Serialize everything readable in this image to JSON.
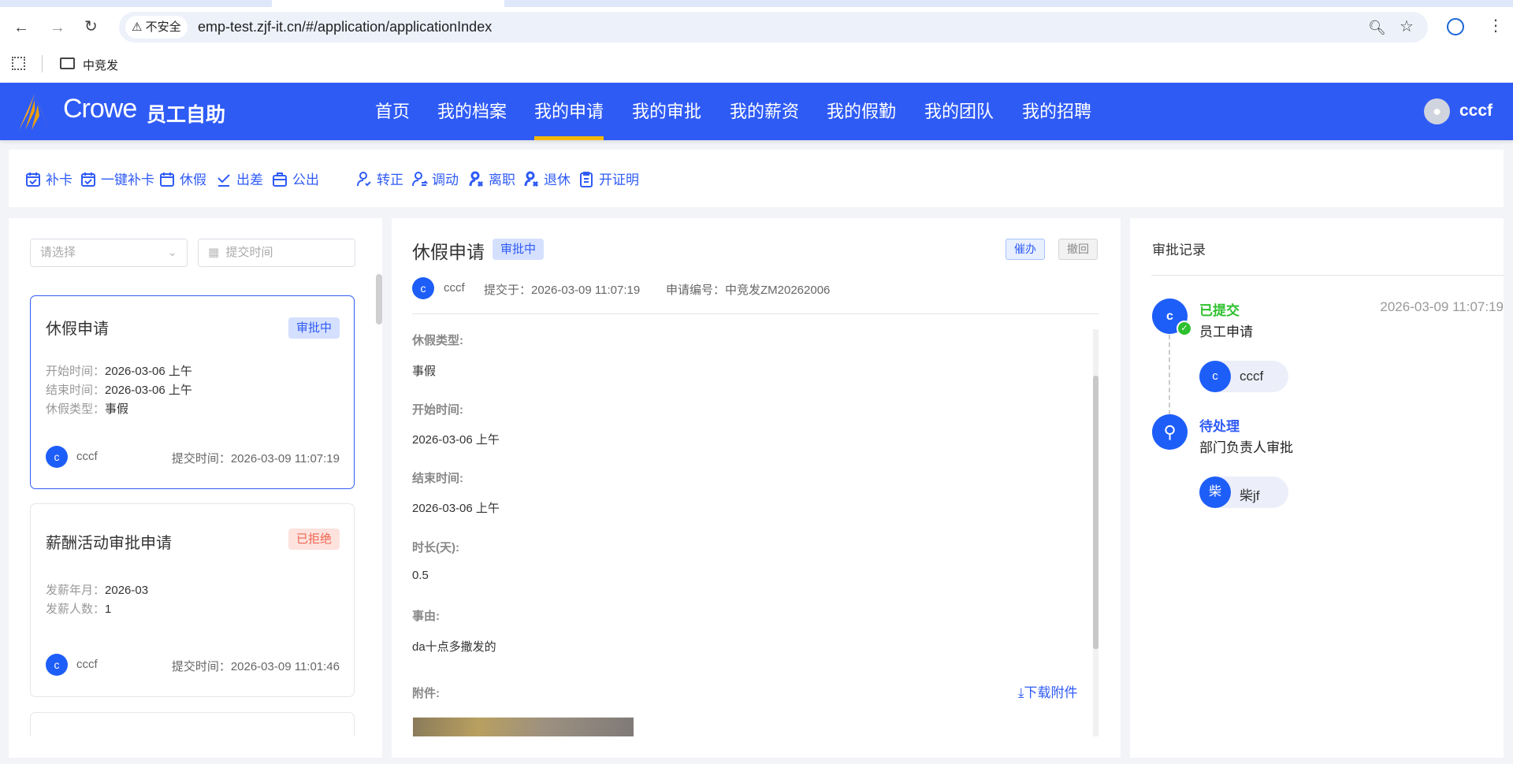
{
  "browser": {
    "insecure_label": "不安全",
    "url": "emp-test.zjf-it.cn/#/application/applicationIndex",
    "bookmark": "中竞发"
  },
  "header": {
    "brand": "Crowe",
    "app_name": "员工自助",
    "user": "cccf",
    "nav": [
      {
        "label": "首页"
      },
      {
        "label": "我的档案"
      },
      {
        "label": "我的申请",
        "active": true
      },
      {
        "label": "我的审批"
      },
      {
        "label": "我的薪资"
      },
      {
        "label": "我的假勤"
      },
      {
        "label": "我的团队"
      },
      {
        "label": "我的招聘"
      }
    ]
  },
  "toolbar": [
    {
      "label": "补卡",
      "icon": "calendar-check-icon"
    },
    {
      "label": "一键补卡",
      "icon": "calendar-check-icon"
    },
    {
      "label": "休假",
      "icon": "calendar-leave-icon"
    },
    {
      "label": "出差",
      "icon": "trip-icon"
    },
    {
      "label": "公出",
      "icon": "briefcase-icon"
    },
    {
      "label": "转正",
      "icon": "user-check-icon"
    },
    {
      "label": "调动",
      "icon": "user-transfer-icon"
    },
    {
      "label": "离职",
      "icon": "user-leave-icon"
    },
    {
      "label": "退休",
      "icon": "user-retire-icon"
    },
    {
      "label": "开证明",
      "icon": "clipboard-icon"
    }
  ],
  "list": {
    "status_placeholder": "请选择",
    "date_placeholder": "提交时间",
    "cards": [
      {
        "title": "休假申请",
        "status": "审批中",
        "rows": [
          {
            "k": "开始时间：",
            "v": "2026-03-06 上午"
          },
          {
            "k": "结束时间：",
            "v": "2026-03-06 上午"
          },
          {
            "k": "休假类型：",
            "v": "事假"
          }
        ],
        "avatar": "c",
        "user": "cccf",
        "submit": "提交时间：2026-03-09 11:07:19"
      },
      {
        "title": "薪酬活动审批申请",
        "status": "已拒绝",
        "rows": [
          {
            "k": "发薪年月：",
            "v": "2026-03"
          },
          {
            "k": "发薪人数：",
            "v": "1"
          }
        ],
        "avatar": "c",
        "user": "cccf",
        "submit": "提交时间：2026-03-09 11:01:46"
      }
    ]
  },
  "detail": {
    "title": "休假申请",
    "status": "审批中",
    "urge": "催办",
    "withdraw": "撤回",
    "avatar": "c",
    "user": "cccf",
    "submitted": "提交于：2026-03-09 11:07:19",
    "number": "申请编号：中竞发ZM20262006",
    "fields": [
      {
        "label": "休假类型:",
        "value": "事假"
      },
      {
        "label": "开始时间:",
        "value": "2026-03-06 上午"
      },
      {
        "label": "结束时间:",
        "value": "2026-03-06 上午"
      },
      {
        "label": "时长(天):",
        "value": "0.5"
      },
      {
        "label": "事由:",
        "value": "da十点多撒发的"
      }
    ],
    "attachment_label": "附件:",
    "download": "下载附件"
  },
  "record": {
    "title": "审批记录",
    "steps": [
      {
        "status": "已提交",
        "name": "员工申请",
        "time": "2026-03-09 11:07:19",
        "avatar": "c",
        "person_avatar": "c",
        "person": "cccf",
        "color": "#2ec02e"
      },
      {
        "status": "待处理",
        "name": "部门负责人审批",
        "person_avatar": "柴",
        "person": "柴jf",
        "color": "#2f5bf5"
      }
    ]
  }
}
